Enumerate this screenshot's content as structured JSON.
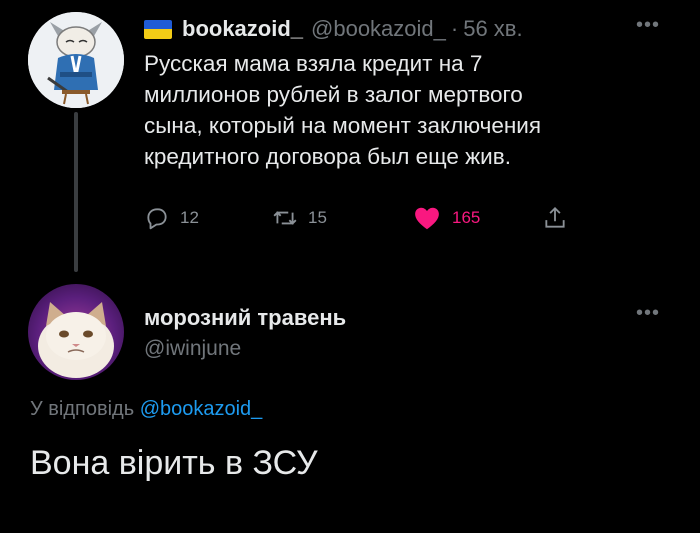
{
  "tweet": {
    "flag_icon": "ukraine-flag-icon",
    "display_name": "bookazoid_",
    "handle": "@bookazoid_",
    "separator": "·",
    "time": "56 хв.",
    "more_icon": "more-horizontal-icon",
    "text_lines": [
      "Русская мама взяла кредит на 7",
      "миллионов рублей в залог мертвого",
      "сына, который на момент заключения",
      "кредитного договора был еще жив."
    ],
    "actions": {
      "reply_count": "12",
      "retweet_count": "15",
      "like_count": "165"
    },
    "colors": {
      "like": "#f91880",
      "secondary_text": "#71767b"
    }
  },
  "reply": {
    "display_name": "морозний травень",
    "handle": "@iwinjune",
    "more_icon": "more-horizontal-icon",
    "replying_prefix": "У відповідь",
    "replying_to": "@bookazoid_",
    "text": "Вона вірить в ЗСУ",
    "colors": {
      "mention": "#1d9bf0"
    }
  }
}
